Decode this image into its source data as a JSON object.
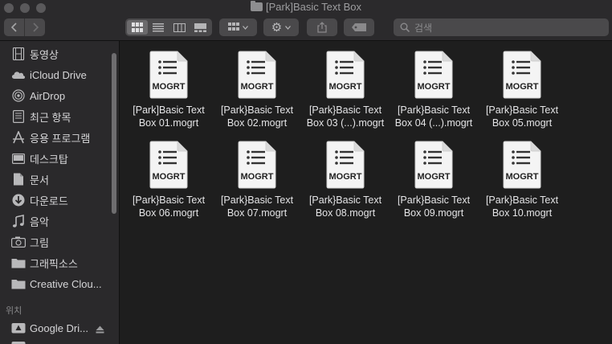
{
  "window": {
    "title": "[Park]Basic Text Box"
  },
  "toolbar": {
    "search_placeholder": "검색"
  },
  "sidebar": {
    "favorites": [
      {
        "label": "동영상",
        "icon": "film-icon"
      },
      {
        "label": "iCloud Drive",
        "icon": "cloud-icon"
      },
      {
        "label": "AirDrop",
        "icon": "airdrop-icon"
      },
      {
        "label": "최근 항목",
        "icon": "recents-icon"
      },
      {
        "label": "응용 프로그램",
        "icon": "applications-icon"
      },
      {
        "label": "데스크탑",
        "icon": "desktop-icon"
      },
      {
        "label": "문서",
        "icon": "document-icon"
      },
      {
        "label": "다운로드",
        "icon": "download-icon"
      },
      {
        "label": "음악",
        "icon": "music-icon"
      },
      {
        "label": "그림",
        "icon": "camera-icon"
      },
      {
        "label": "그래픽소스",
        "icon": "folder-icon"
      },
      {
        "label": "Creative Clou...",
        "icon": "folder-icon"
      }
    ],
    "locations_header": "위치",
    "locations": [
      {
        "label": "Google Dri...",
        "icon": "drive-icon"
      }
    ]
  },
  "files": [
    {
      "line1": "[Park]Basic Text",
      "line2": "Box 01.mogrt",
      "badge": "MOGRT"
    },
    {
      "line1": "[Park}Basic Text",
      "line2": "Box 02.mogrt",
      "badge": "MOGRT"
    },
    {
      "line1": "[Park}Basic Text",
      "line2": "Box 03 (...).mogrt",
      "badge": "MOGRT"
    },
    {
      "line1": "[Park}Basic Text",
      "line2": "Box 04 (...).mogrt",
      "badge": "MOGRT"
    },
    {
      "line1": "[Park}Basic Text",
      "line2": "Box 05.mogrt",
      "badge": "MOGRT"
    },
    {
      "line1": "[Park}Basic Text",
      "line2": "Box 06.mogrt",
      "badge": "MOGRT"
    },
    {
      "line1": "[Park}Basic Text",
      "line2": "Box 07.mogrt",
      "badge": "MOGRT"
    },
    {
      "line1": "[Park}Basic Text",
      "line2": "Box 08.mogrt",
      "badge": "MOGRT"
    },
    {
      "line1": "[Park}Basic Text",
      "line2": "Box 09.mogrt",
      "badge": "MOGRT"
    },
    {
      "line1": "[Park}Basic Text",
      "line2": "Box 10.mogrt",
      "badge": "MOGRT"
    }
  ]
}
